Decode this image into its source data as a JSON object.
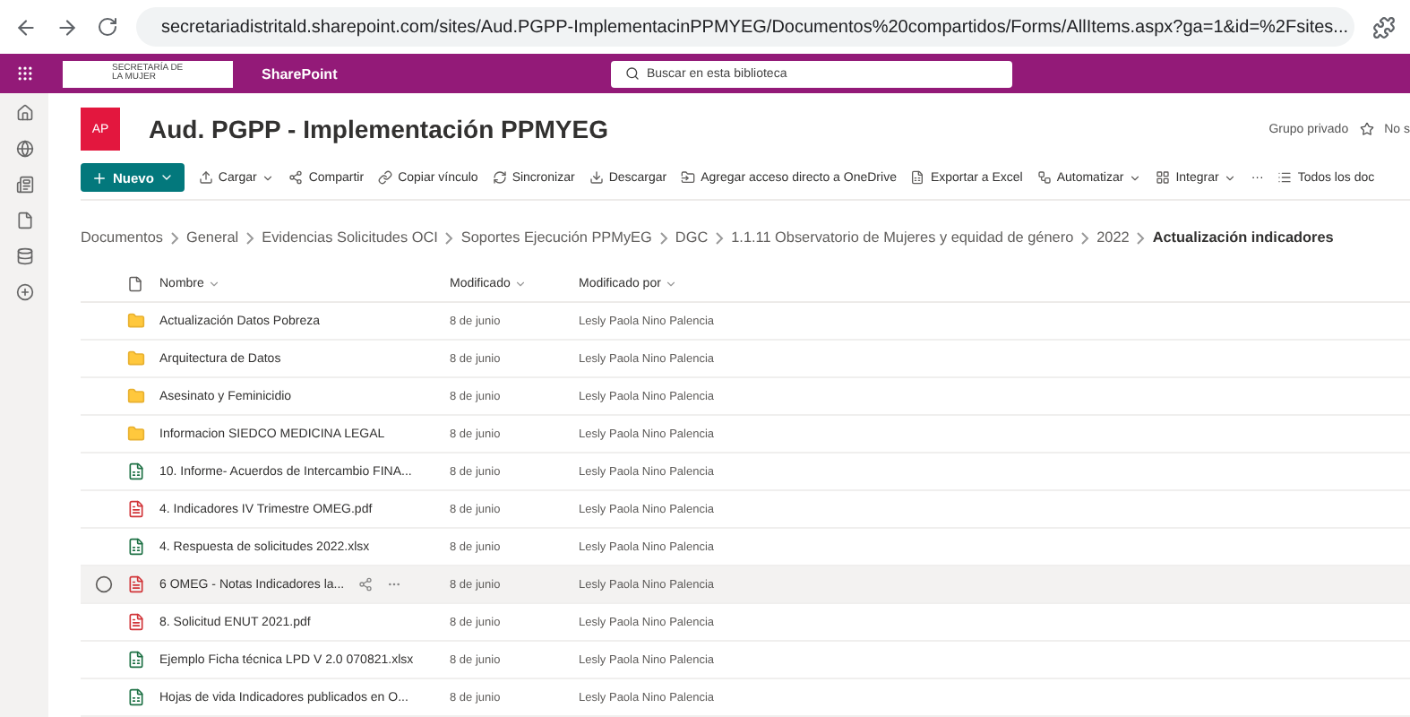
{
  "browser": {
    "url": "secretariadistritald.sharepoint.com/sites/Aud.PGPP-ImplementacinPPMYEG/Documentos%20compartidos/Forms/AllItems.aspx?ga=1&id=%2Fsites..."
  },
  "suite_bar": {
    "org_logo_text": "SECRETARÍA DE LA MUJER",
    "app_name": "SharePoint",
    "search": {
      "placeholder": "Buscar en esta biblioteca"
    }
  },
  "site": {
    "initials": "AP",
    "title": "Aud. PGPP - Implementación PPMYEG",
    "privacy": "Grupo privado",
    "follow": "No s"
  },
  "toolbar": {
    "new_button": "Nuevo",
    "items": [
      {
        "label": "Cargar",
        "dropdown": true
      },
      {
        "label": "Compartir",
        "dropdown": false
      },
      {
        "label": "Copiar vínculo",
        "dropdown": false
      },
      {
        "label": "Sincronizar",
        "dropdown": false
      },
      {
        "label": "Descargar",
        "dropdown": false
      },
      {
        "label": "Agregar acceso directo a OneDrive",
        "dropdown": false
      },
      {
        "label": "Exportar a Excel",
        "dropdown": false
      },
      {
        "label": "Automatizar",
        "dropdown": true
      },
      {
        "label": "Integrar",
        "dropdown": true
      },
      {
        "label": "···",
        "dropdown": false
      },
      {
        "label": "Todos los doc",
        "dropdown": false
      }
    ]
  },
  "breadcrumb": [
    {
      "label": "Documentos",
      "current": false
    },
    {
      "label": "General",
      "current": false
    },
    {
      "label": "Evidencias Solicitudes OCI",
      "current": false
    },
    {
      "label": "Soportes Ejecución PPMyEG",
      "current": false
    },
    {
      "label": "DGC",
      "current": false
    },
    {
      "label": "1.1.11 Observatorio de Mujeres y equidad de género",
      "current": false
    },
    {
      "label": "2022",
      "current": false
    },
    {
      "label": "Actualización indicadores",
      "current": true
    }
  ],
  "table": {
    "columns": [
      "Nombre",
      "Modificado",
      "Modificado por"
    ],
    "rows": [
      {
        "kind": "folder",
        "name": "Actualización Datos Pobreza",
        "modified": "8 de junio",
        "modified_by": "Lesly Paola Nino Palencia",
        "hovered": false
      },
      {
        "kind": "folder",
        "name": "Arquitectura de Datos",
        "modified": "8 de junio",
        "modified_by": "Lesly Paola Nino Palencia",
        "hovered": false
      },
      {
        "kind": "folder",
        "name": "Asesinato y Feminicidio",
        "modified": "8 de junio",
        "modified_by": "Lesly Paola Nino Palencia",
        "hovered": false
      },
      {
        "kind": "folder",
        "name": "Informacion SIEDCO MEDICINA LEGAL",
        "modified": "8 de junio",
        "modified_by": "Lesly Paola Nino Palencia",
        "hovered": false
      },
      {
        "kind": "excel",
        "name": "10. Informe- Acuerdos de Intercambio FINA...",
        "modified": "8 de junio",
        "modified_by": "Lesly Paola Nino Palencia",
        "hovered": false
      },
      {
        "kind": "pdf",
        "name": "4. Indicadores IV Trimestre OMEG.pdf",
        "modified": "8 de junio",
        "modified_by": "Lesly Paola Nino Palencia",
        "hovered": false
      },
      {
        "kind": "excel",
        "name": "4. Respuesta de solicitudes  2022.xlsx",
        "modified": "8 de junio",
        "modified_by": "Lesly Paola Nino Palencia",
        "hovered": false
      },
      {
        "kind": "pdf",
        "name": "6 OMEG - Notas Indicadores la...",
        "modified": "8 de junio",
        "modified_by": "Lesly Paola Nino Palencia",
        "hovered": true
      },
      {
        "kind": "pdf",
        "name": "8. Solicitud ENUT 2021.pdf",
        "modified": "8 de junio",
        "modified_by": "Lesly Paola Nino Palencia",
        "hovered": false
      },
      {
        "kind": "excel",
        "name": "Ejemplo Ficha técnica LPD V 2.0 070821.xlsx",
        "modified": "8 de junio",
        "modified_by": "Lesly Paola Nino Palencia",
        "hovered": false
      },
      {
        "kind": "excel",
        "name": "Hojas de vida Indicadores publicados en O...",
        "modified": "8 de junio",
        "modified_by": "Lesly Paola Nino Palencia",
        "hovered": false
      }
    ]
  }
}
